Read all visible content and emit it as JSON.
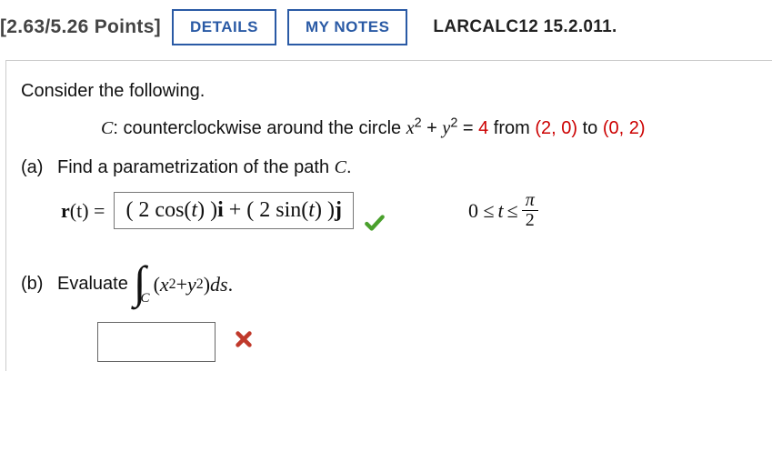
{
  "header": {
    "points_label": "[2.63/5.26 Points]",
    "details_btn": "DETAILS",
    "notes_btn": "MY NOTES",
    "source_ref": "LARCALC12 15.2.011."
  },
  "prompt": {
    "consider": "Consider the following.",
    "c_label": "C",
    "c_desc_prefix": ": counterclockwise around the circle ",
    "c_eq_lhs_x": "x",
    "c_eq_plus": " + ",
    "c_eq_lhs_y": "y",
    "c_eq_eqrhs": " = ",
    "c_eq_rhs": "4",
    "c_from": " from ",
    "c_pt1": "(2, 0)",
    "c_to": " to ",
    "c_pt2": "(0, 2)"
  },
  "parts": {
    "a": {
      "label": "(a)",
      "text_prefix": "Find a parametrization of the path ",
      "text_c": "C",
      "text_suffix": ".",
      "r_label": "r",
      "r_of_t": "(t) = ",
      "answer": "( 2 cos(t) )i + ( 2 sin(t) )j",
      "range_prefix": "0 ≤ ",
      "range_t": "t",
      "range_mid": " ≤ ",
      "range_num": "π",
      "range_den": "2"
    },
    "b": {
      "label": "(b)",
      "text": "Evaluate",
      "int_sub": "C",
      "integrand_open": "(",
      "integrand_x": "x",
      "integrand_plus": " + ",
      "integrand_y": "y",
      "integrand_close": ") ",
      "ds": "ds",
      "period": "."
    }
  }
}
